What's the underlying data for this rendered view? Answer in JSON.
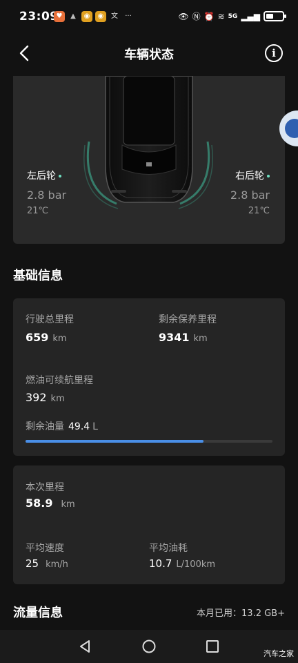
{
  "status_bar": {
    "time": "23:09",
    "network": "5G"
  },
  "header": {
    "title": "车辆状态"
  },
  "tires": {
    "left": {
      "label": "左后轮",
      "pressure": "2.8 bar",
      "temp": "21℃"
    },
    "right": {
      "label": "右后轮",
      "pressure": "2.8 bar",
      "temp": "21℃"
    }
  },
  "basic_info": {
    "title": "基础信息",
    "total_mileage": {
      "label": "行驶总里程",
      "value": "659",
      "unit": "km"
    },
    "maintenance": {
      "label": "剩余保养里程",
      "value": "9341",
      "unit": "km"
    },
    "fuel_range": {
      "label": "燃油可续航里程",
      "value": "392",
      "unit": "km"
    },
    "fuel_remaining": {
      "label": "剩余油量",
      "value": "49.4",
      "unit": "L",
      "level_fraction": 0.72
    }
  },
  "trip": {
    "current": {
      "label": "本次里程",
      "value": "58.9",
      "unit": "km"
    },
    "avg_speed": {
      "label": "平均速度",
      "value": "25",
      "unit": "km/h"
    },
    "avg_fuel": {
      "label": "平均油耗",
      "value": "10.7",
      "unit": "L/100km"
    }
  },
  "traffic": {
    "title": "流量信息",
    "used": "本月已用：13.2 GB+"
  },
  "watermark": "汽车之家",
  "colors": {
    "accent": "#4a8fe7",
    "tire_glow": "#3fbf9f",
    "card_bg": "#252525"
  }
}
